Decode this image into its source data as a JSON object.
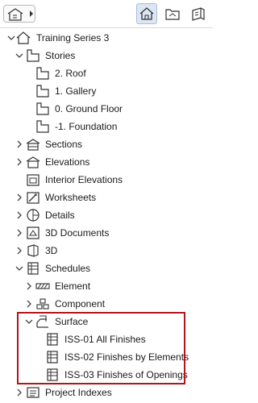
{
  "toolbar": {
    "dropdown_icon": "view-map-icon",
    "buttons": [
      {
        "name": "project-map",
        "icon": "house-icon",
        "active": true
      },
      {
        "name": "view-map",
        "icon": "folder-house-icon",
        "active": false
      },
      {
        "name": "layout-book",
        "icon": "layout-book-icon",
        "active": false
      }
    ]
  },
  "tree": {
    "root": "Training Series 3",
    "stories_label": "Stories",
    "stories": [
      "2. Roof",
      "1. Gallery",
      "0. Ground Floor",
      "-1. Foundation"
    ],
    "sections": "Sections",
    "elevations": "Elevations",
    "interior_elevations": "Interior Elevations",
    "worksheets": "Worksheets",
    "details": "Details",
    "documents_3d": "3D Documents",
    "view_3d": "3D",
    "schedules": "Schedules",
    "element": "Element",
    "component": "Component",
    "surface": "Surface",
    "surface_items": [
      "ISS-01 All Finishes",
      "ISS-02 Finishes by Elements",
      "ISS-03 Finishes of Openings"
    ],
    "project_indexes": "Project Indexes"
  },
  "colors": {
    "highlight": "#b5121b",
    "active_button": "#dde7f3"
  }
}
